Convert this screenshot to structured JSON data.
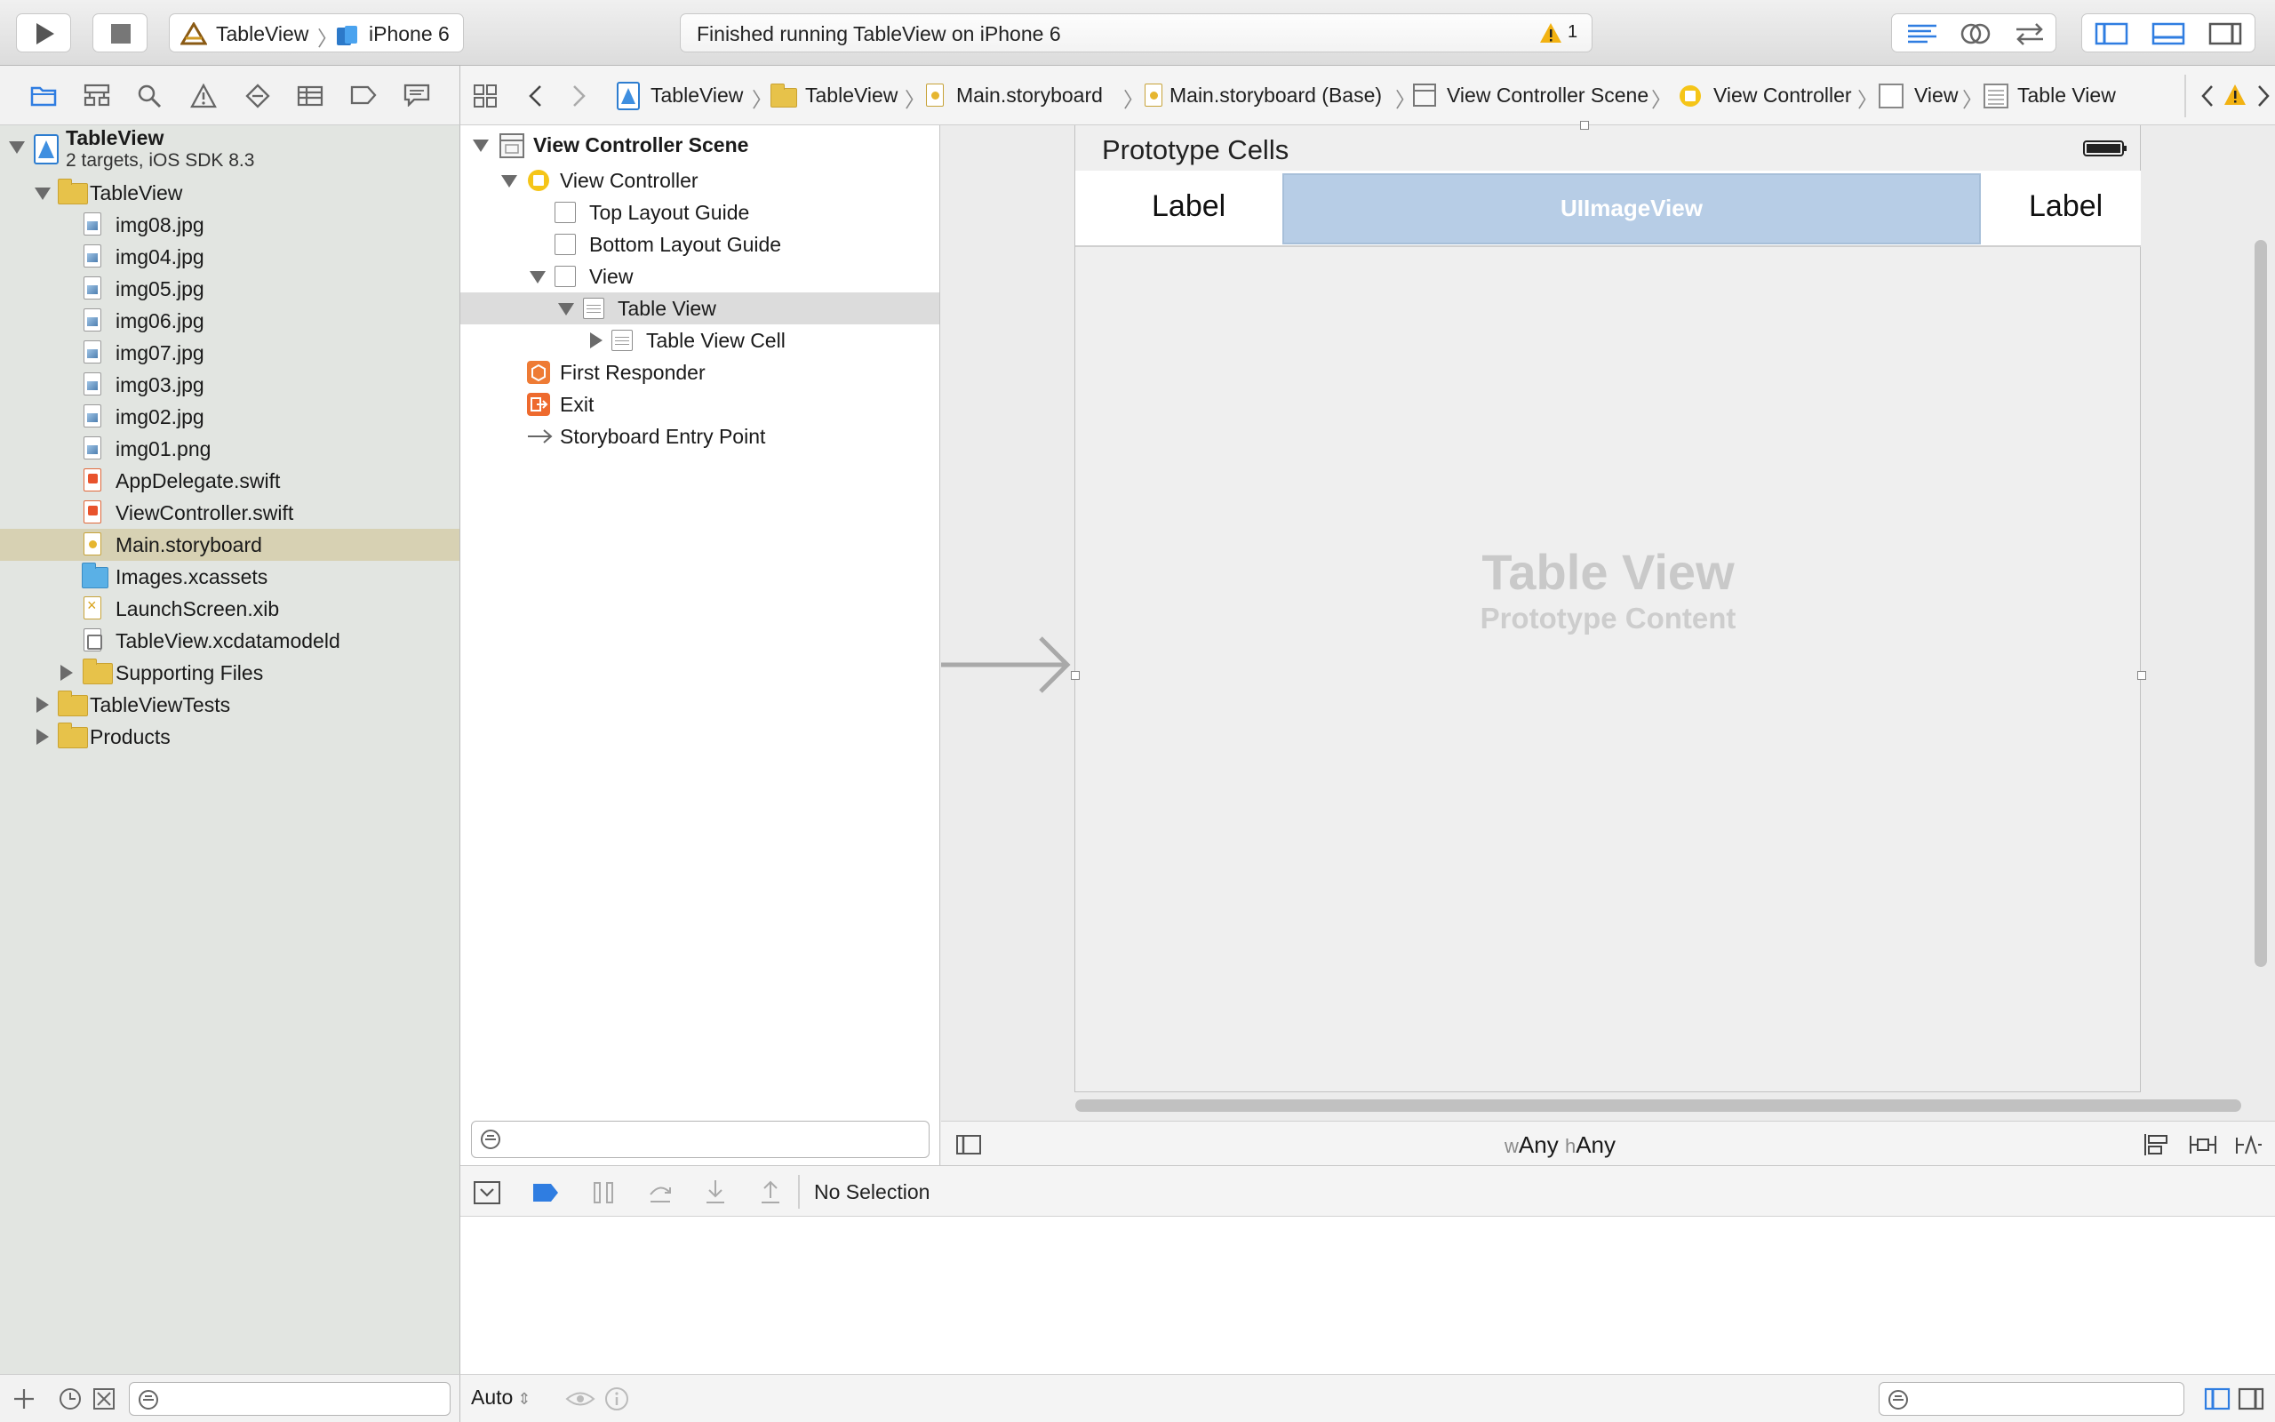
{
  "toolbar": {
    "scheme_project": "TableView",
    "scheme_device": "iPhone 6",
    "status_message": "Finished running TableView on iPhone 6",
    "warning_count": "1"
  },
  "navigator": {
    "project_name": "TableView",
    "project_subtitle": "2 targets, iOS SDK 8.3",
    "group_name": "TableView",
    "files": [
      "img08.jpg",
      "img04.jpg",
      "img05.jpg",
      "img06.jpg",
      "img07.jpg",
      "img03.jpg",
      "img02.jpg",
      "img01.png",
      "AppDelegate.swift",
      "ViewController.swift",
      "Main.storyboard",
      "Images.xcassets",
      "LaunchScreen.xib",
      "TableView.xcdatamodeld"
    ],
    "supporting_files": "Supporting Files",
    "tests_group": "TableViewTests",
    "products_group": "Products",
    "selected_file": "Main.storyboard"
  },
  "jumpbar": {
    "crumbs": [
      "TableView",
      "TableView",
      "Main.storyboard",
      "Main.storyboard (Base)",
      "View Controller Scene",
      "View Controller",
      "View",
      "Table View"
    ]
  },
  "outline": {
    "scene": "View Controller Scene",
    "view_controller": "View Controller",
    "top_layout_guide": "Top Layout Guide",
    "bottom_layout_guide": "Bottom Layout Guide",
    "view": "View",
    "table_view": "Table View",
    "table_view_cell": "Table View Cell",
    "first_responder": "First Responder",
    "exit": "Exit",
    "entry_point": "Storyboard Entry Point"
  },
  "canvas": {
    "prototype_cells": "Prototype Cells",
    "left_label": "Label",
    "image_view": "UIImageView",
    "right_label": "Label",
    "placeholder_title": "Table View",
    "placeholder_subtitle": "Prototype Content",
    "size_w_prefix": "w",
    "size_w": "Any",
    "size_h_prefix": "h",
    "size_h": "Any"
  },
  "debug": {
    "no_selection": "No Selection",
    "auto": "Auto"
  }
}
